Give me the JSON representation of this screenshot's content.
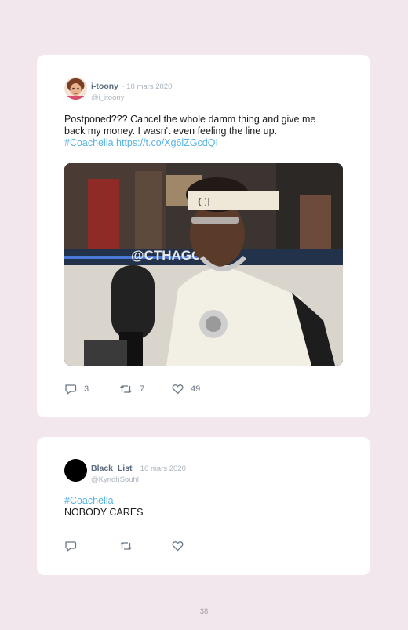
{
  "tweets": [
    {
      "name": "i-toony",
      "date": "· 10 mars 2020",
      "handle": "@i_itoony",
      "text_line1": "Postponed??? Cancel the whole damm thing and give me",
      "text_line2": "back my money. I wasn't even feeling the line up.",
      "hashtag": "#Coachella",
      "url": "https://t.co/Xg6lZGcdQI",
      "media_caption": "@CTHAGO",
      "headband_text": "CI",
      "reply_count": "3",
      "retweet_count": "7",
      "like_count": "49"
    },
    {
      "name": "Black_List",
      "date": "· 10 mars 2020",
      "handle": "@KyndhSouhl",
      "hashtag": "#Coachella",
      "text": "NOBODY CARES"
    }
  ],
  "page_number": "38",
  "colors": {
    "background": "#f1e7ec",
    "link": "#57b3e8",
    "name": "#5a6b7f"
  },
  "icons": [
    "reply-icon",
    "retweet-icon",
    "like-icon"
  ]
}
